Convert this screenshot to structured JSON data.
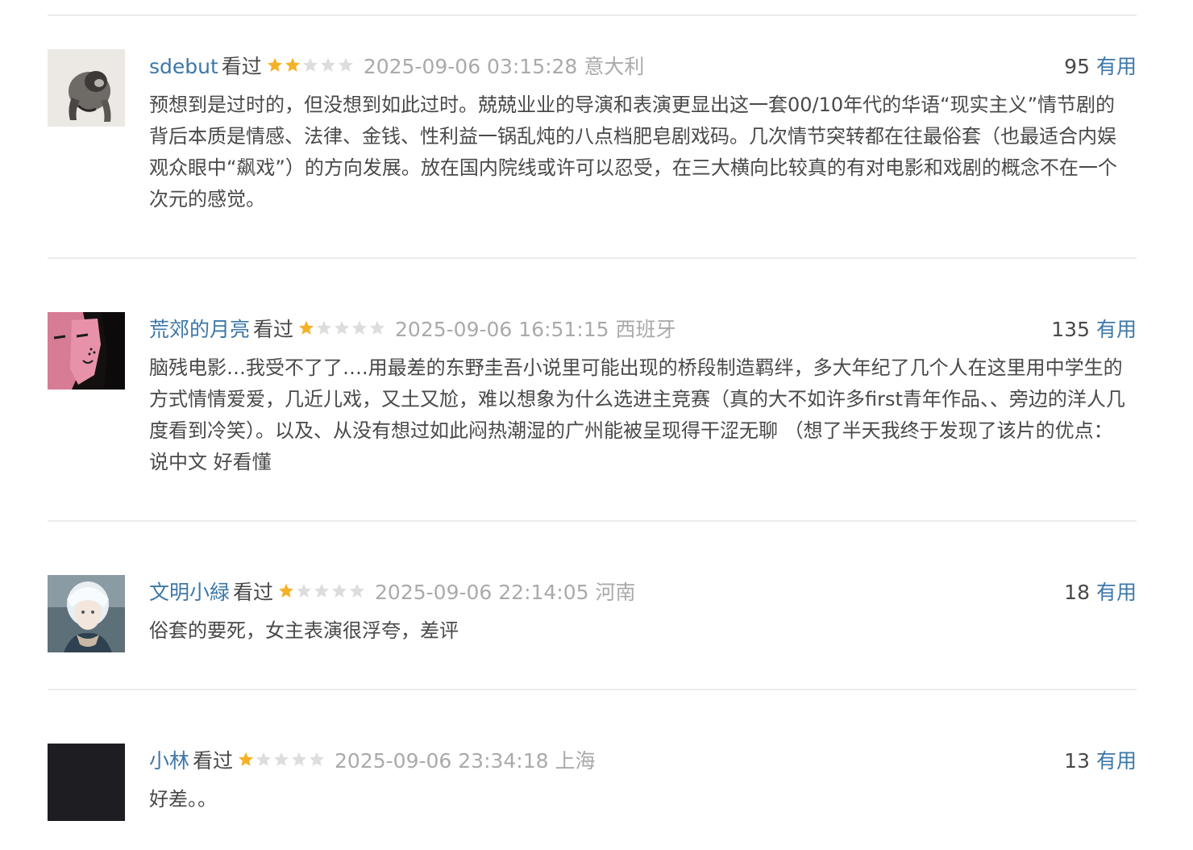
{
  "comments": [
    {
      "author": "sdebut",
      "status": "看过",
      "rating": 2,
      "time": "2025-09-06 03:15:28",
      "location": "意大利",
      "votes": "95",
      "useful_label": "有用",
      "text": "预想到是过时的，但没想到如此过时。兢兢业业的导演和表演更显出这一套00/10年代的华语“现实主义”情节剧的背后本质是情感、法律、金钱、性利益一锅乱炖的八点档肥皂剧戏码。几次情节突转都在往最俗套（也最适合内娱观众眼中“飙戏”）的方向发展。放在国内院线或许可以忍受，在三大横向比较真的有对电影和戏剧的概念不在一个次元的感觉。"
    },
    {
      "author": "荒郊的月亮",
      "status": "看过",
      "rating": 1,
      "time": "2025-09-06 16:51:15",
      "location": "西班牙",
      "votes": "135",
      "useful_label": "有用",
      "text": "脑残电影…我受不了了….用最差的东野圭吾小说里可能出现的桥段制造羁绊，多大年纪了几个人在这里用中学生的方式情情爱爱，几近儿戏，又土又尬，难以想象为什么选进主竞赛（真的大不如许多first青年作品、、旁边的洋人几度看到冷笑）。以及、从没有想过如此闷热潮湿的广州能被呈现得干涩无聊 （想了半天我终于发现了该片的优点：说中文 好看懂"
    },
    {
      "author": "文明小緑",
      "status": "看过",
      "rating": 1,
      "time": "2025-09-06 22:14:05",
      "location": "河南",
      "votes": "18",
      "useful_label": "有用",
      "text": "俗套的要死，女主表演很浮夸，差评"
    },
    {
      "author": "小林",
      "status": "看过",
      "rating": 1,
      "time": "2025-09-06 23:34:18",
      "location": "上海",
      "votes": "13",
      "useful_label": "有用",
      "text": "好差。。"
    }
  ],
  "colors": {
    "link": "#3d77a8",
    "star_on": "#f5b126",
    "star_off": "#dddddd",
    "muted": "#aaaaaa",
    "text": "#494949"
  }
}
